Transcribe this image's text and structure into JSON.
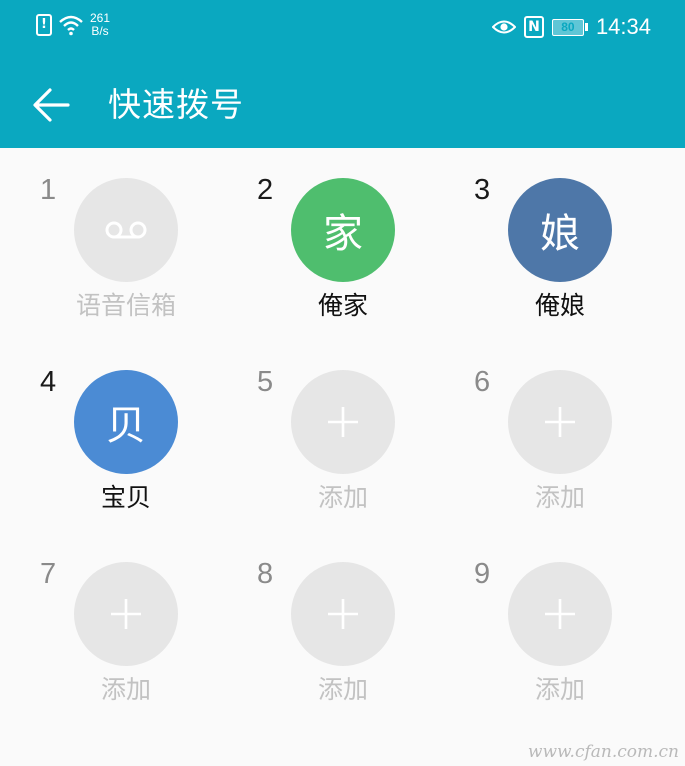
{
  "status_bar": {
    "net_speed_value": "261",
    "net_speed_unit": "B/s",
    "battery": "80",
    "time": "14:34",
    "icons": [
      "sim-alert-icon",
      "wifi-icon",
      "eye-comfort-icon",
      "nfc-icon",
      "battery-icon"
    ]
  },
  "header": {
    "title": "快速拨号",
    "back_icon": "arrow-left-icon",
    "background": "#0aa8c0"
  },
  "speed_dials": [
    {
      "number": "1",
      "label": "语音信箱",
      "avatar_text": "",
      "color": "#e6e6e6",
      "icon": "voicemail-icon"
    },
    {
      "number": "2",
      "label": "俺家",
      "avatar_text": "家",
      "color": "#4fbe6e"
    },
    {
      "number": "3",
      "label": "俺娘",
      "avatar_text": "娘",
      "color": "#4e77a8"
    },
    {
      "number": "4",
      "label": "宝贝",
      "avatar_text": "贝",
      "color": "#4b8bd4"
    },
    {
      "number": "5",
      "label": "添加",
      "avatar_text": "",
      "color": "#e6e6e6",
      "icon": "plus-icon"
    },
    {
      "number": "6",
      "label": "添加",
      "avatar_text": "",
      "color": "#e6e6e6",
      "icon": "plus-icon"
    },
    {
      "number": "7",
      "label": "添加",
      "avatar_text": "",
      "color": "#e6e6e6",
      "icon": "plus-icon"
    },
    {
      "number": "8",
      "label": "添加",
      "avatar_text": "",
      "color": "#e6e6e6",
      "icon": "plus-icon"
    },
    {
      "number": "9",
      "label": "添加",
      "avatar_text": "",
      "color": "#e6e6e6",
      "icon": "plus-icon"
    }
  ],
  "watermark": "www.cfan.com.cn"
}
